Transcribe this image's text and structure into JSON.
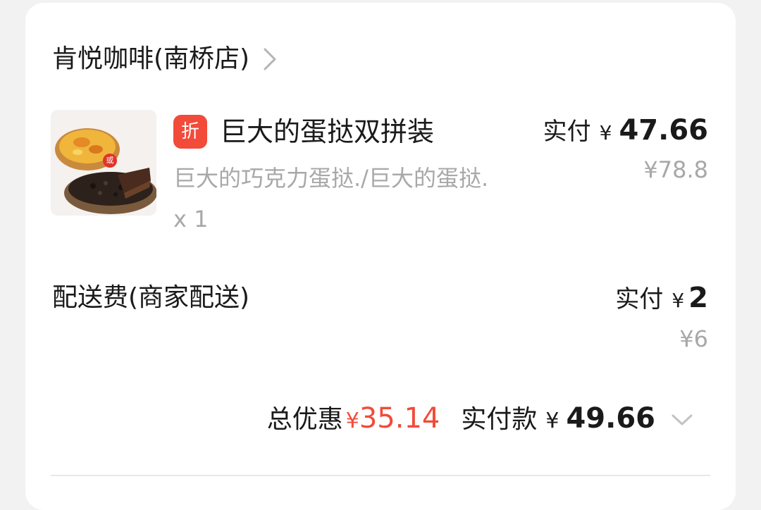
{
  "store": {
    "name": "肯悦咖啡(南桥店)",
    "icon": "chevron-right-icon"
  },
  "item": {
    "badge": "折",
    "name": "巨大的蛋挞双拼装",
    "description": "巨大的巧克力蛋挞./巨大的蛋挞.",
    "quantity": "x 1",
    "paid_label": "实付",
    "paid_currency": "¥",
    "paid_value": "47.66",
    "original_price": "¥78.8",
    "image_badge": "或"
  },
  "delivery": {
    "label": "配送费(商家配送)",
    "paid_label": "实付",
    "paid_currency": "¥",
    "paid_value": "2",
    "original_price": "¥6"
  },
  "summary": {
    "discount_label": "总优惠",
    "discount_currency": "¥",
    "discount_value": "35.14",
    "total_label": "实付款",
    "total_currency": "¥",
    "total_value": "49.66",
    "icon": "chevron-down-icon"
  },
  "colors": {
    "accent_red": "#f24b3a",
    "text_primary": "#1a1a1a",
    "text_secondary": "#a8a8a8",
    "card_bg": "#ffffff",
    "page_bg": "#f2f2f2"
  }
}
